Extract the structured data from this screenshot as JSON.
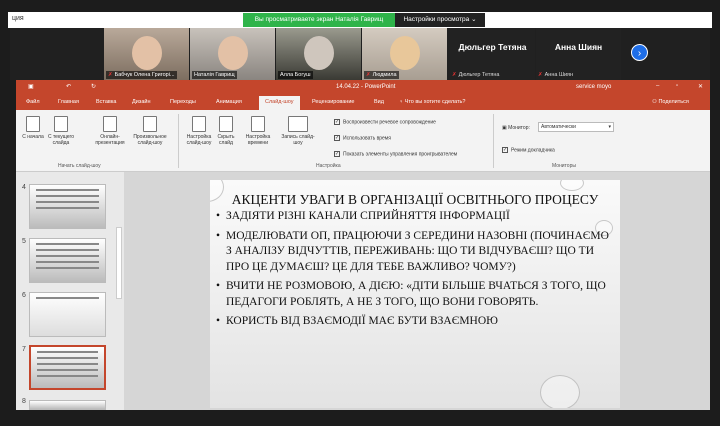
{
  "zoom": {
    "left_label": "ция",
    "banner": "Вы просматриваете экран Наталія Гаврищ",
    "view_options": "Настройки просмотра ⌄",
    "participants": [
      {
        "name": "Бабчук Олена Григорі..."
      },
      {
        "name": "Наталія Гаврищ"
      },
      {
        "name": "Алла Богуш"
      },
      {
        "name": "Людмила"
      }
    ],
    "name_tiles": [
      {
        "big": "Дюльгер Тетяна",
        "name": "Дюльгер Тетяна"
      },
      {
        "big": "Анна Шиян",
        "name": "Анна Шиян"
      }
    ],
    "next": "›"
  },
  "ppt": {
    "title": "14.04.22 - PowerPoint",
    "user": "service moyo",
    "share": "Поделиться",
    "tabs": [
      "Файл",
      "Главная",
      "Вставка",
      "Дизайн",
      "Переходы",
      "Анимация",
      "Слайд-шоу",
      "Рецензирование",
      "Вид",
      "Что вы хотите сделать?"
    ],
    "ribbon": {
      "buttons": [
        "С начала",
        "С текущего слайда",
        "Онлайн-презентация",
        "Произвольное слайд-шоу",
        "Настройка слайд-шоу",
        "Скрыть слайд",
        "Настройка времени",
        "Запись слайд-шоу"
      ],
      "checks": [
        "Воспроизвести речевое сопровождение",
        "Использовать время",
        "Показать элементы управления проигрывателем"
      ],
      "monitor_label": "Монитор:",
      "monitor_value": "Автоматически",
      "presenter": "Режим докладчика",
      "groups": [
        "Начать слайд-шоу",
        "Настройка",
        "Мониторы"
      ]
    },
    "slide_numbers": [
      "4",
      "5",
      "6",
      "7",
      "8"
    ],
    "slide": {
      "title": "АКЦЕНТИ УВАГИ В ОРГАНІЗАЦІЇ ОСВІТНЬОГО ПРОЦЕСУ",
      "bullets": [
        "ЗАДІЯТИ РІЗНІ КАНАЛИ СПРИЙНЯТТЯ ІНФОРМАЦІЇ",
        "МОДЕЛЮВАТИ ОП, ПРАЦЮЮЧИ З СЕРЕДИНИ НАЗОВНІ (ПОЧИНАЄМО З АНАЛІЗУ ВІДЧУТТІВ, ПЕРЕЖИВАНЬ: ЩО ТИ ВІДЧУВАЄШ? ЩО ТИ ПРО ЦЕ ДУМАЄШ? ЦЕ ДЛЯ ТЕБЕ ВАЖЛИВО? ЧОМУ?)",
        "ВЧИТИ НЕ РОЗМОВОЮ, А ДІЄЮ: «ДІТИ БІЛЬШЕ ВЧАТЬСЯ З ТОГО, ЩО ПЕДАГОГИ РОБЛЯТЬ, А НЕ З ТОГО, ЩО ВОНИ ГОВОРЯТЬ.",
        "КОРИСТЬ ВІД ВЗАЄМОДІЇ МАЄ БУТИ ВЗАЄМНОЮ"
      ]
    }
  }
}
